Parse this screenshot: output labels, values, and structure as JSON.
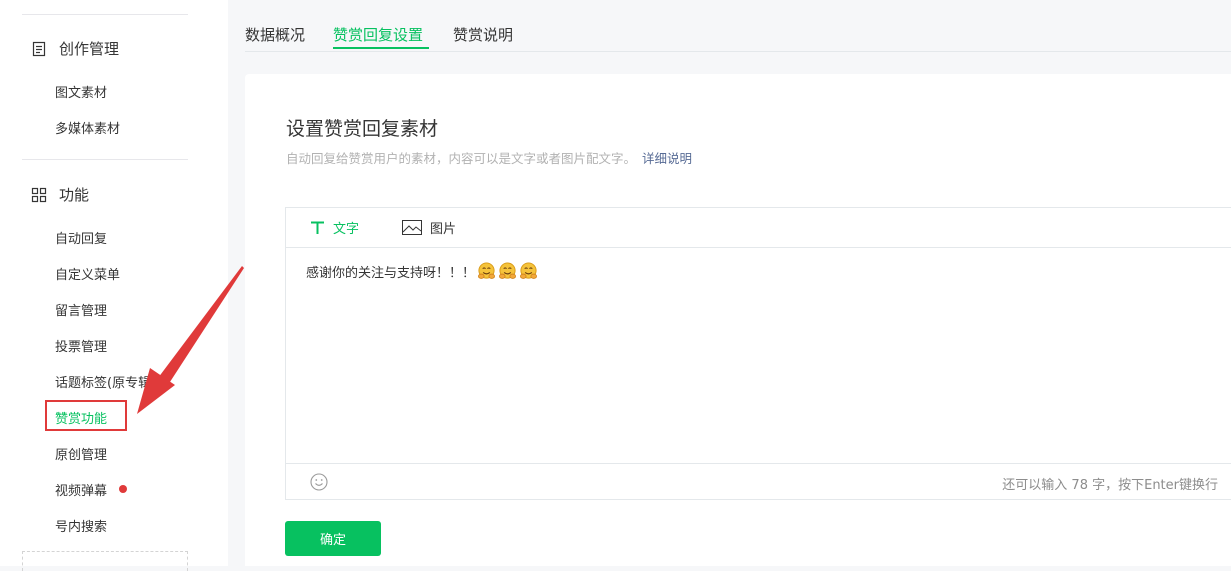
{
  "sidebar": {
    "sections": [
      {
        "title": "创作管理",
        "icon": "document-icon",
        "items": [
          "图文素材",
          "多媒体素材"
        ]
      },
      {
        "title": "功能",
        "icon": "grid-icon",
        "items": [
          "自动回复",
          "自定义菜单",
          "留言管理",
          "投票管理",
          "话题标签(原专辑",
          "赞赏功能",
          "原创管理",
          "视频弹幕",
          "号内搜索"
        ]
      }
    ],
    "active_item": "赞赏功能"
  },
  "tabs": [
    {
      "label": "数据概况",
      "active": false
    },
    {
      "label": "赞赏回复设置",
      "active": true
    },
    {
      "label": "赞赏说明",
      "active": false
    }
  ],
  "card": {
    "title": "设置赞赏回复素材",
    "description": "自动回复给赞赏用户的素材，内容可以是文字或者图片配文字。",
    "detail_link": "详细说明",
    "editor": {
      "tabs": [
        {
          "label": "文字",
          "icon": "text-icon",
          "active": true
        },
        {
          "label": "图片",
          "icon": "image-icon",
          "active": false
        }
      ],
      "content": "感谢你的关注与支持呀！！！",
      "emoji_count": 3,
      "counter": "还可以输入 78 字，按下Enter键换行"
    },
    "confirm_label": "确定"
  },
  "colors": {
    "accent": "#07c160",
    "highlight": "#e03a3a",
    "link": "#576b95"
  }
}
